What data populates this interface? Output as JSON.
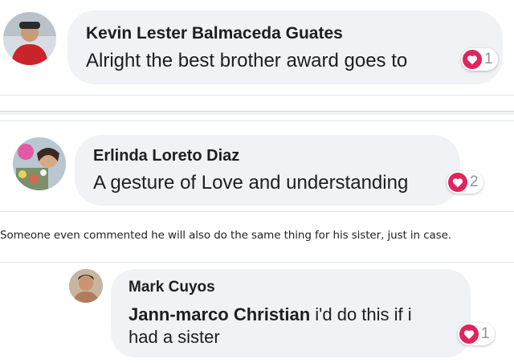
{
  "comments": [
    {
      "author": "Kevin Lester Balmaceda Guates",
      "text": "Alright the best brother award goes to",
      "reaction_count": "1",
      "reaction_icon": "heart-icon",
      "reaction_color": "#e0245e"
    },
    {
      "author": "Erlinda Loreto Diaz",
      "text": "A gesture of Love and understanding",
      "reaction_count": "2",
      "reaction_icon": "heart-icon",
      "reaction_color": "#e0245e"
    },
    {
      "author": "Mark Cuyos",
      "mention": "Jann-marco Christian",
      "text_line1": " i'd do this if i",
      "text_line2": "had a sister",
      "reaction_count": "1",
      "reaction_icon": "heart-icon",
      "reaction_color": "#e0245e"
    }
  ],
  "caption": "Someone even commented he will also do the same thing for his sister, just in case."
}
